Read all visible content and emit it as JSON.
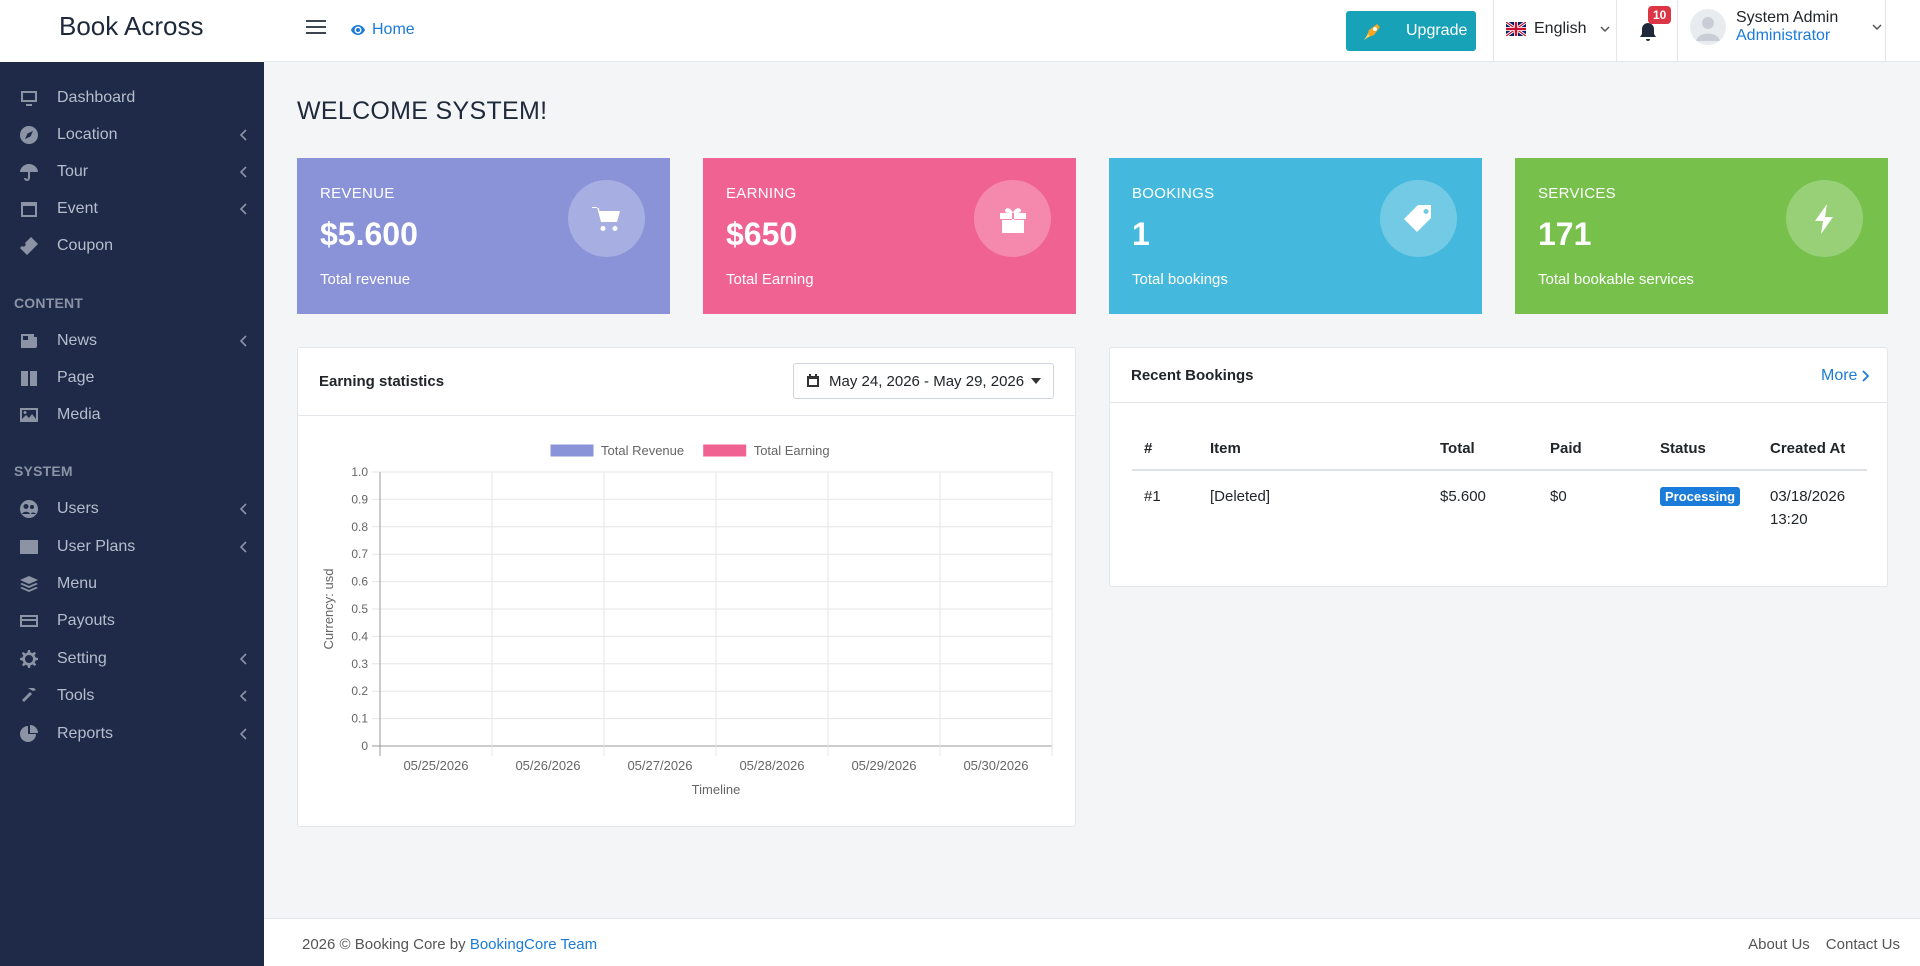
{
  "app": {
    "brand": "Book Across"
  },
  "topbar": {
    "home_label": "Home",
    "upgrade_label": "Upgrade",
    "language": "English",
    "notification_count": "10",
    "user_name": "System Admin",
    "user_role": "Administrator"
  },
  "sidebar": {
    "items_top": [
      {
        "label": "Dashboard",
        "icon": "monitor-icon",
        "has_arrow": false
      },
      {
        "label": "Location",
        "icon": "compass-icon",
        "has_arrow": true
      },
      {
        "label": "Tour",
        "icon": "umbrella-icon",
        "has_arrow": true
      },
      {
        "label": "Event",
        "icon": "calendar-icon",
        "has_arrow": true
      },
      {
        "label": "Coupon",
        "icon": "ticket-icon",
        "has_arrow": false
      }
    ],
    "content_header": "CONTENT",
    "items_content": [
      {
        "label": "News",
        "icon": "newspaper-icon",
        "has_arrow": true
      },
      {
        "label": "Page",
        "icon": "book-icon",
        "has_arrow": false
      },
      {
        "label": "Media",
        "icon": "image-icon",
        "has_arrow": false
      }
    ],
    "system_header": "SYSTEM",
    "items_system": [
      {
        "label": "Users",
        "icon": "users-icon",
        "has_arrow": true
      },
      {
        "label": "User Plans",
        "icon": "list-icon",
        "has_arrow": true
      },
      {
        "label": "Menu",
        "icon": "layers-icon",
        "has_arrow": false
      },
      {
        "label": "Payouts",
        "icon": "credit-card-icon",
        "has_arrow": false
      },
      {
        "label": "Setting",
        "icon": "gear-icon",
        "has_arrow": true
      },
      {
        "label": "Tools",
        "icon": "hammer-icon",
        "has_arrow": true
      },
      {
        "label": "Reports",
        "icon": "pie-chart-icon",
        "has_arrow": true
      }
    ]
  },
  "main": {
    "welcome": "WELCOME SYSTEM!",
    "cards": [
      {
        "title": "REVENUE",
        "value": "$5.600",
        "subtitle": "Total revenue",
        "color": "#8a93d8",
        "icon": "cart-icon"
      },
      {
        "title": "EARNING",
        "value": "$650",
        "subtitle": "Total Earning",
        "color": "#f06292",
        "icon": "gift-icon"
      },
      {
        "title": "BOOKINGS",
        "value": "1",
        "subtitle": "Total bookings",
        "color": "#45b9dd",
        "icon": "tag-icon"
      },
      {
        "title": "SERVICES",
        "value": "171",
        "subtitle": "Total bookable services",
        "color": "#76c04b",
        "icon": "bolt-icon"
      }
    ],
    "earning": {
      "title": "Earning statistics",
      "date_range": "May 24, 2026 - May 29, 2026"
    },
    "recent": {
      "title": "Recent Bookings",
      "more_label": "More",
      "columns": [
        "#",
        "Item",
        "Total",
        "Paid",
        "Status",
        "Created At"
      ],
      "rows": [
        {
          "id": "#1",
          "item": "[Deleted]",
          "total": "$5.600",
          "paid": "$0",
          "status": "Processing",
          "created_date": "03/18/2026",
          "created_time": "13:20"
        }
      ]
    }
  },
  "chart_data": {
    "type": "bar",
    "categories": [
      "05/25/2026",
      "05/26/2026",
      "05/27/2026",
      "05/28/2026",
      "05/29/2026",
      "05/30/2026"
    ],
    "series": [
      {
        "name": "Total Revenue",
        "values": [
          0,
          0,
          0,
          0,
          0,
          0
        ],
        "color": "#8a93d8"
      },
      {
        "name": "Total Earning",
        "values": [
          0,
          0,
          0,
          0,
          0,
          0
        ],
        "color": "#f06292"
      }
    ],
    "y_ticks": [
      "1.0",
      "0.9",
      "0.8",
      "0.7",
      "0.6",
      "0.5",
      "0.4",
      "0.3",
      "0.2",
      "0.1",
      "0"
    ],
    "xlabel": "Timeline",
    "ylabel": "Currency: usd",
    "ylim": [
      0,
      1
    ],
    "grid": true,
    "legend": "top-center"
  },
  "footer": {
    "copyright": "2026 © Booking Core by",
    "team_link": "BookingCore Team",
    "about": "About Us",
    "contact": "Contact Us"
  }
}
